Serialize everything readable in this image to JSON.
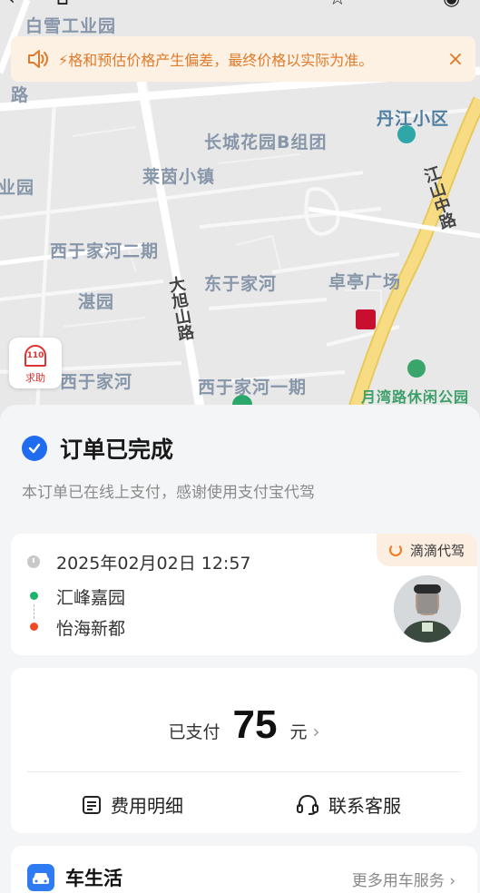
{
  "top_icons": {
    "back": "back-arrow-icon",
    "home": "home-icon",
    "favorite": "star-icon",
    "more": "more-icon",
    "target": "target-icon"
  },
  "notice": {
    "text": "⚡格和预估价格产生偏差，最终价格以实际为准。",
    "icon": "speaker-icon",
    "close": "×"
  },
  "map": {
    "labels": {
      "baixue": "白雪工业园",
      "lu_left": "路",
      "yeyuan": "业园",
      "danjiang": "丹江小区",
      "changcheng": "长城花园B组团",
      "laiyin": "莱茵小镇",
      "jiangshan": "江山中路",
      "xiyu2": "西于家河二期",
      "daxu": "大旭山路",
      "dongyu": "东于家河",
      "zhuoting": "卓亭广场",
      "zhanyuan": "湛园",
      "xiyu": "西于家河",
      "xiyu1": "西于家河一期",
      "yuewan": "月湾路休闲公园"
    }
  },
  "sos": {
    "number": "110",
    "label": "求助"
  },
  "order": {
    "status": "订单已完成",
    "subtitle": "本订单已在线上支付，感谢使用支付宝代驾",
    "brand": "滴滴代驾",
    "time": "2025年02月02日 12:57",
    "from": "汇峰嘉园",
    "to": "怡海新都"
  },
  "payment": {
    "prefix": "已支付",
    "amount": "75",
    "unit": "元",
    "chevron": "›",
    "fee_detail": "费用明细",
    "customer_service": "联系客服"
  },
  "car_life": {
    "title": "车生活",
    "more": "更多用车服务 ›"
  },
  "colors": {
    "accent_blue": "#1f6cf0",
    "notice_orange": "#e07a2a",
    "start_green": "#1bb46a",
    "end_red": "#f04a23",
    "road_yellow": "#f6d774"
  }
}
